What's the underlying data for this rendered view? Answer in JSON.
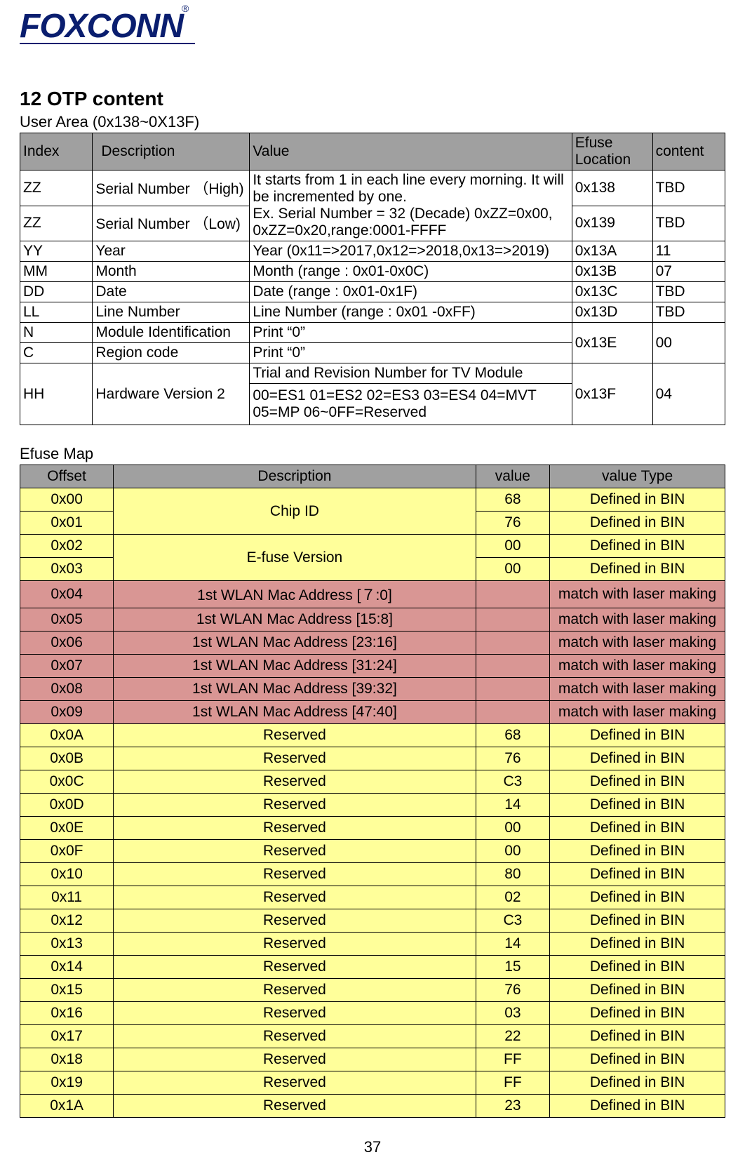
{
  "logo_text": "FOXCONN",
  "section_title": "12 OTP content",
  "user_area_title": "User Area (0x138~0X13F)",
  "table1": {
    "headers": [
      "Index",
      "Description",
      "Value",
      "Efuse Location",
      "content"
    ],
    "r1": {
      "idx": "ZZ",
      "desc": "Serial Number （High)",
      "loc": "0x138",
      "cont": "TBD"
    },
    "r2": {
      "idx": "ZZ",
      "desc": "Serial Number （Low)",
      "loc": "0x139",
      "cont": "TBD"
    },
    "serial_value": "It starts from 1 in each line every morning. It will be incremented by one.\nEx. Serial Number = 32 (Decade) 0xZZ=0x00, 0xZZ=0x20,range:0001-FFFF",
    "r3": {
      "idx": "YY",
      "desc": "Year",
      "val": "Year (0x11=>2017,0x12=>2018,0x13=>2019)",
      "loc": "0x13A",
      "cont": "11"
    },
    "r4": {
      "idx": "MM",
      "desc": "Month",
      "val": "Month (range : 0x01-0x0C)",
      "loc": "0x13B",
      "cont": "07"
    },
    "r5": {
      "idx": "DD",
      "desc": "Date",
      "val": "Date (range : 0x01-0x1F)",
      "loc": "0x13C",
      "cont": "TBD"
    },
    "r6": {
      "idx": "LL",
      "desc": "Line Number",
      "val": "Line Number (range : 0x01 -0xFF)",
      "loc": "0x13D",
      "cont": "TBD"
    },
    "r7": {
      "idx": "N",
      "desc": "Module Identification",
      "val": "Print “0”"
    },
    "r8": {
      "idx": "C",
      "desc": "Region code",
      "val": "Print “0”"
    },
    "nc_loc": "0x13E",
    "nc_cont": "00",
    "r9": {
      "idx": "HH",
      "desc": "Hardware Version 2",
      "val_a": "Trial and Revision Number for TV Module",
      "val_b": "00=ES1 01=ES2 02=ES3 03=ES4 04=MVT 05=MP 06~0FF=Reserved",
      "loc": "0x13F",
      "cont": "04"
    }
  },
  "efuse_map_title": "Efuse Map",
  "table2": {
    "headers": [
      "Offset",
      "Description",
      "value",
      "value Type"
    ],
    "rows": [
      {
        "off": "0x00",
        "desc": "Chip ID",
        "val": "68",
        "type": "Defined in BIN",
        "cls": "yellow",
        "merge_desc": 2
      },
      {
        "off": "0x01",
        "desc": "",
        "val": "76",
        "type": "Defined in BIN",
        "cls": "yellow"
      },
      {
        "off": "0x02",
        "desc": "E-fuse Version",
        "val": "00",
        "type": "Defined in BIN",
        "cls": "yellow",
        "merge_desc": 2
      },
      {
        "off": "0x03",
        "desc": "",
        "val": "00",
        "type": "Defined in BIN",
        "cls": "yellow"
      },
      {
        "off": "0x04",
        "desc": "1st WLAN Mac Address [７:0]",
        "val": "",
        "type": "match with laser making",
        "cls": "pink"
      },
      {
        "off": "0x05",
        "desc": "1st WLAN Mac Address [15:8]",
        "val": "",
        "type": "match with laser making",
        "cls": "pink"
      },
      {
        "off": "0x06",
        "desc": "1st WLAN Mac Address [23:16]",
        "val": "",
        "type": "match with laser making",
        "cls": "pink"
      },
      {
        "off": "0x07",
        "desc": "1st WLAN Mac Address [31:24]",
        "val": "",
        "type": "match with laser making",
        "cls": "pink"
      },
      {
        "off": "0x08",
        "desc": "1st WLAN Mac Address [39:32]",
        "val": "",
        "type": "match with laser making",
        "cls": "pink"
      },
      {
        "off": "0x09",
        "desc": "1st WLAN Mac Address [47:40]",
        "val": "",
        "type": "match with laser making",
        "cls": "pink"
      },
      {
        "off": "0x0A",
        "desc": "Reserved",
        "val": "68",
        "type": "Defined in BIN",
        "cls": "yellow"
      },
      {
        "off": "0x0B",
        "desc": "Reserved",
        "val": "76",
        "type": "Defined in BIN",
        "cls": "yellow"
      },
      {
        "off": "0x0C",
        "desc": "Reserved",
        "val": "C3",
        "type": "Defined in BIN",
        "cls": "yellow"
      },
      {
        "off": "0x0D",
        "desc": "Reserved",
        "val": "14",
        "type": "Defined in BIN",
        "cls": "yellow"
      },
      {
        "off": "0x0E",
        "desc": "Reserved",
        "val": "00",
        "type": "Defined in BIN",
        "cls": "yellow"
      },
      {
        "off": "0x0F",
        "desc": "Reserved",
        "val": "00",
        "type": "Defined in BIN",
        "cls": "yellow"
      },
      {
        "off": "0x10",
        "desc": "Reserved",
        "val": "80",
        "type": "Defined in BIN",
        "cls": "yellow"
      },
      {
        "off": "0x11",
        "desc": "Reserved",
        "val": "02",
        "type": "Defined in BIN",
        "cls": "yellow"
      },
      {
        "off": "0x12",
        "desc": "Reserved",
        "val": "C3",
        "type": "Defined in BIN",
        "cls": "yellow"
      },
      {
        "off": "0x13",
        "desc": "Reserved",
        "val": "14",
        "type": "Defined in BIN",
        "cls": "yellow"
      },
      {
        "off": "0x14",
        "desc": "Reserved",
        "val": "15",
        "type": "Defined in BIN",
        "cls": "yellow"
      },
      {
        "off": "0x15",
        "desc": "Reserved",
        "val": "76",
        "type": "Defined in BIN",
        "cls": "yellow"
      },
      {
        "off": "0x16",
        "desc": "Reserved",
        "val": "03",
        "type": "Defined in BIN",
        "cls": "yellow"
      },
      {
        "off": "0x17",
        "desc": "Reserved",
        "val": "22",
        "type": "Defined in BIN",
        "cls": "yellow"
      },
      {
        "off": "0x18",
        "desc": "Reserved",
        "val": "FF",
        "type": "Defined in BIN",
        "cls": "yellow"
      },
      {
        "off": "0x19",
        "desc": "Reserved",
        "val": "FF",
        "type": "Defined in BIN",
        "cls": "yellow"
      },
      {
        "off": "0x1A",
        "desc": "Reserved",
        "val": "23",
        "type": "Defined in BIN",
        "cls": "yellow"
      }
    ]
  },
  "page_number": "37"
}
